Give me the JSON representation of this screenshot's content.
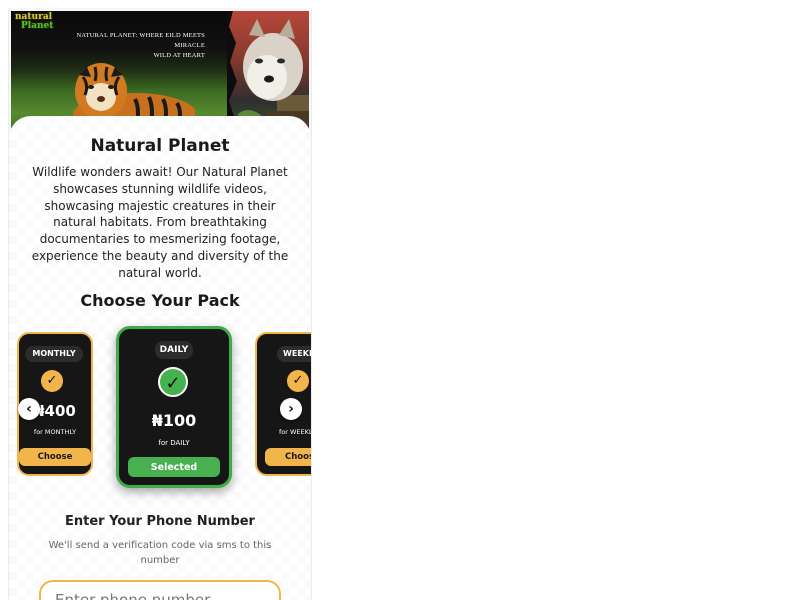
{
  "banner": {
    "logo_line1": "natural",
    "logo_line2": "Planet",
    "tagline_line1": "NATURAL PLANET: WHERE EILD MEETS MIRACLE",
    "tagline_line2": "WILD AT HEART"
  },
  "app": {
    "title": "Natural Planet",
    "description": "Wildlife wonders await! Our Natural Planet showcases stunning wildlife videos, showcasing majestic creatures in their natural habitats. From breathtaking documentaries to mesmerizing footage, experience the beauty and diversity of the natural world."
  },
  "packs": {
    "title": "Choose Your Pack",
    "items": [
      {
        "name": "MONTHLY",
        "price": "₦400",
        "for_text": "for MONTHLY",
        "button": "Choose",
        "selected": false
      },
      {
        "name": "DAILY",
        "price": "₦100",
        "for_text": "for DAILY",
        "button": "Selected",
        "selected": true
      },
      {
        "name": "WEEKLY",
        "price": "",
        "for_text": "for WEEKLY",
        "button": "Choose",
        "selected": false
      }
    ],
    "check_glyph": "✓",
    "prev_icon": "chevron-left-icon",
    "next_icon": "chevron-right-icon"
  },
  "phone": {
    "title": "Enter Your Phone Number",
    "subtitle": "We'll send a verification code via sms to this number",
    "placeholder": "Enter phone number"
  },
  "colors": {
    "accent_orange": "#f2b54a",
    "accent_green": "#49b050",
    "pack_bg": "#161616"
  }
}
